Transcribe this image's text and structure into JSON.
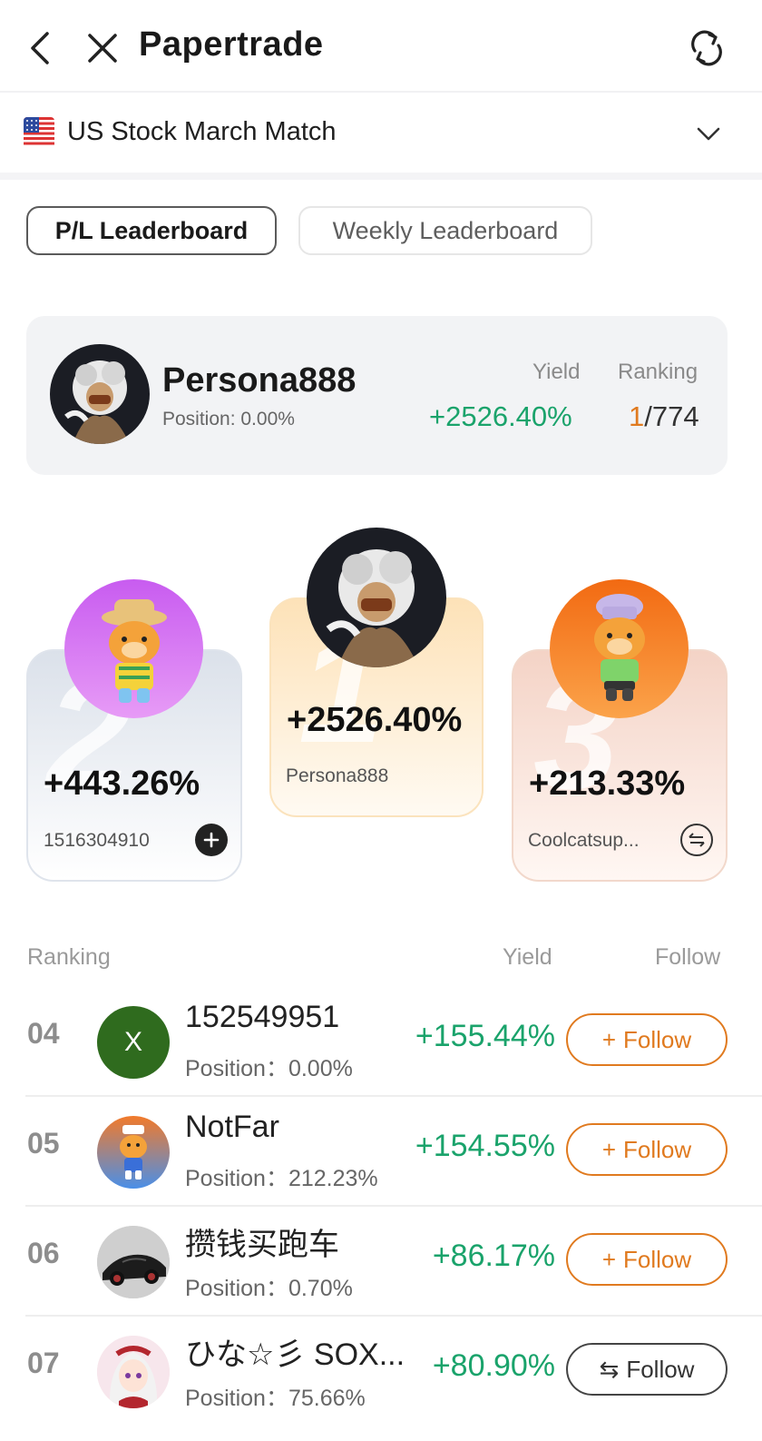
{
  "header": {
    "title": "Papertrade"
  },
  "match": {
    "label": "US Stock March Match"
  },
  "tabs": [
    {
      "label": "P/L Leaderboard",
      "active": true
    },
    {
      "label": "Weekly Leaderboard",
      "active": false
    }
  ],
  "me": {
    "name": "Persona888",
    "position": "Position: 0.00%",
    "yield_label": "Yield",
    "yield": "+2526.40%",
    "ranking_label": "Ranking",
    "rank": "1",
    "total": "/774"
  },
  "podium": [
    {
      "place": "2",
      "yield": "+443.26%",
      "name": "1516304910",
      "action": "add-follow"
    },
    {
      "place": "1",
      "yield": "+2526.40%",
      "name": "Persona888",
      "action": "none"
    },
    {
      "place": "3",
      "yield": "+213.33%",
      "name": "Coolcatsup...",
      "action": "mutual-follow"
    }
  ],
  "list_header": {
    "ranking": "Ranking",
    "yield": "Yield",
    "follow": "Follow"
  },
  "rows": [
    {
      "rank": "04",
      "avatar_letter": "X",
      "name": "152549951",
      "position": "Position：0.00%",
      "yield": "+155.44%",
      "follow_label": "Follow",
      "follow_icon": "+",
      "following": false
    },
    {
      "rank": "05",
      "avatar_letter": "",
      "name": "NotFar",
      "position": "Position：212.23%",
      "yield": "+154.55%",
      "follow_label": "Follow",
      "follow_icon": "+",
      "following": false
    },
    {
      "rank": "06",
      "avatar_letter": "",
      "name": "攒钱买跑车",
      "position": "Position：0.70%",
      "yield": "+86.17%",
      "follow_label": "Follow",
      "follow_icon": "+",
      "following": false
    },
    {
      "rank": "07",
      "avatar_letter": "",
      "name": "ひな☆彡 SOX...",
      "position": "Position：75.66%",
      "yield": "+80.90%",
      "follow_label": "Follow",
      "follow_icon": "⇆",
      "following": true
    }
  ],
  "colors": {
    "positive": "#1aa36b",
    "accent": "#e07a1f"
  }
}
